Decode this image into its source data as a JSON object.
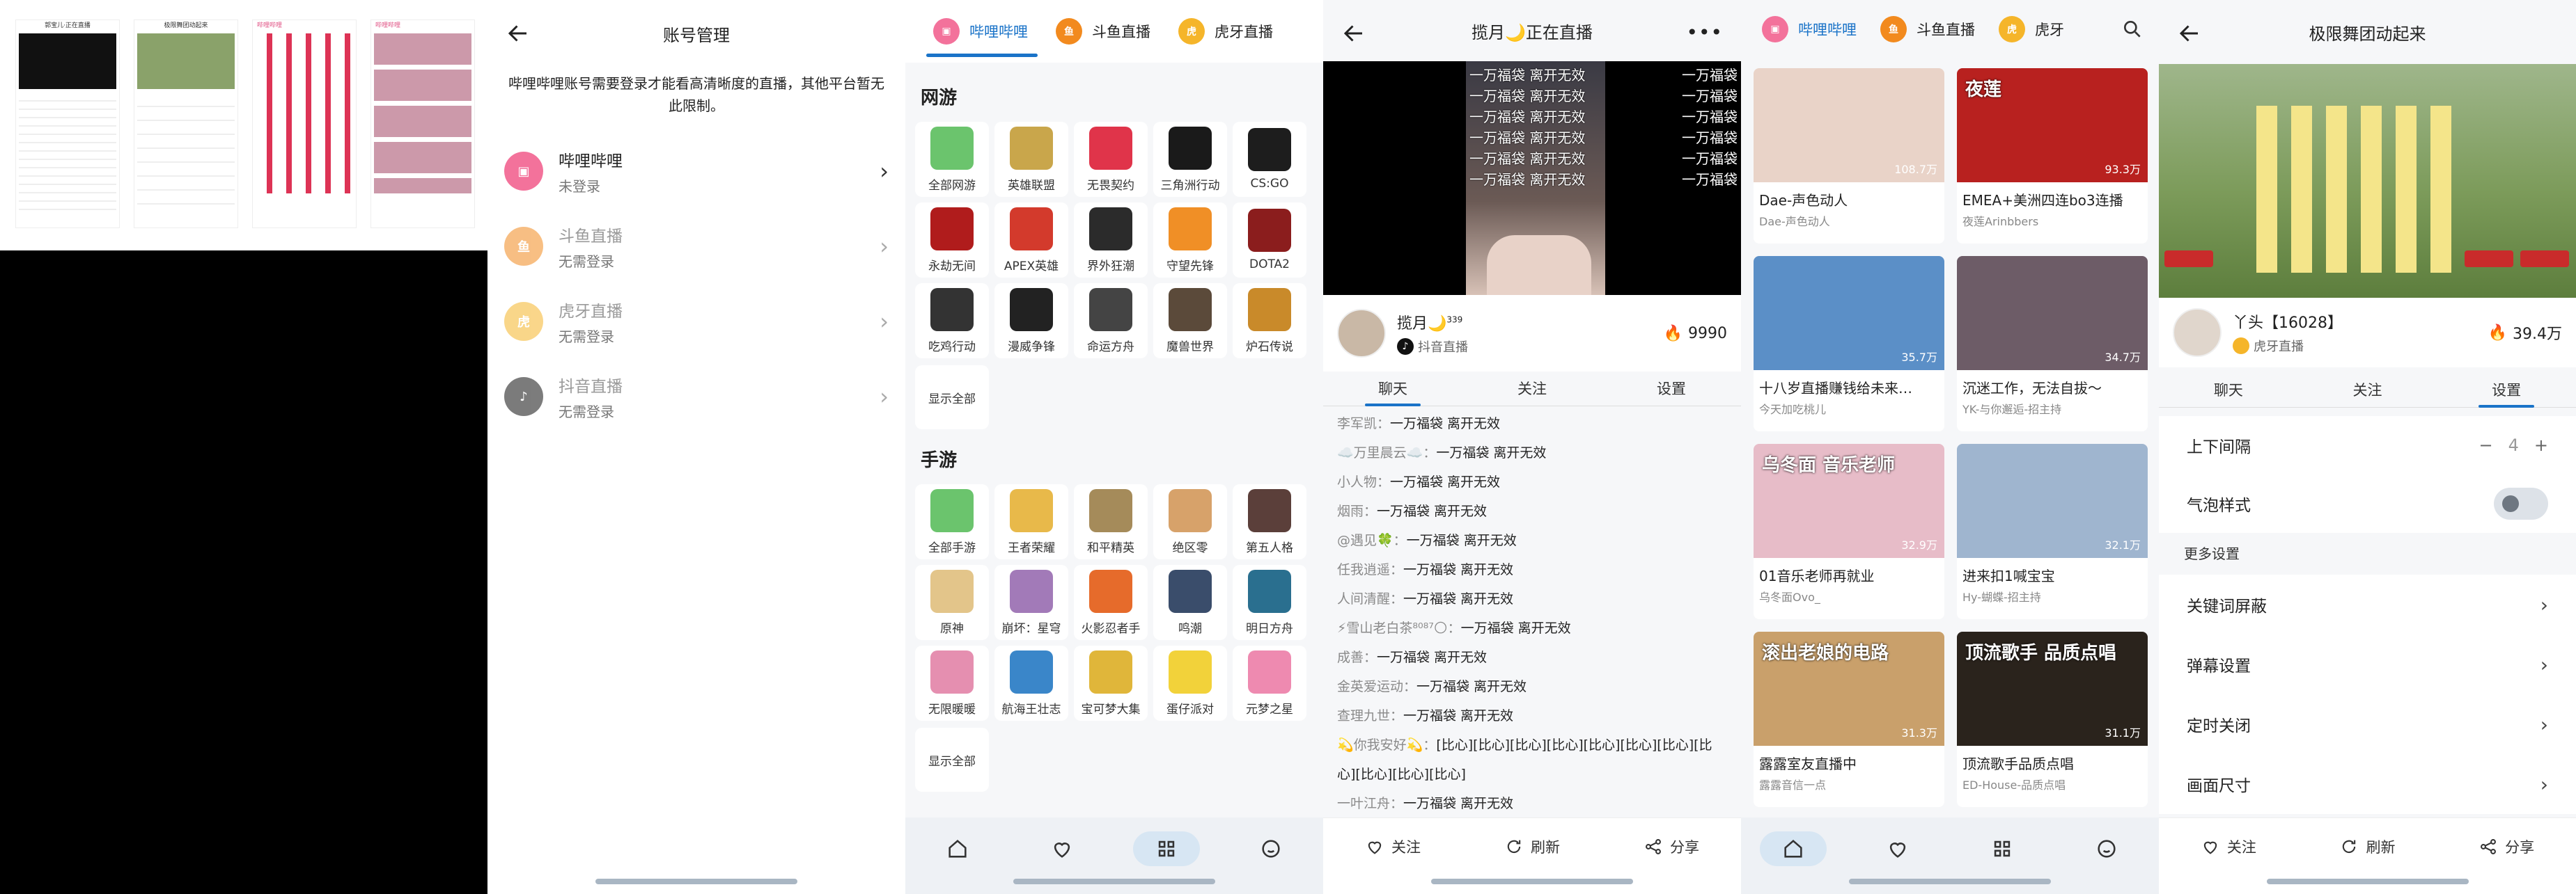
{
  "thumbs": {
    "t1_title": "郭宝儿·正在直播",
    "t2_title": "极限舞团动起来",
    "t3_title": "哔哩哔哩",
    "t4_title": "哔哩哔哩"
  },
  "account": {
    "title": "账号管理",
    "notice": "哔哩哔哩账号需要登录才能看高清晰度的直播，其他平台暂无此限制。",
    "items": [
      {
        "name": "哔哩哔哩",
        "status": "未登录"
      },
      {
        "name": "斗鱼直播",
        "status": "无需登录"
      },
      {
        "name": "虎牙直播",
        "status": "无需登录"
      },
      {
        "name": "抖音直播",
        "status": "无需登录"
      }
    ]
  },
  "categories": {
    "tabs": [
      "哔哩哔哩",
      "斗鱼直播",
      "虎牙直播"
    ],
    "net_title": "网游",
    "net": [
      "全部网游",
      "英雄联盟",
      "无畏契约",
      "三角洲行动",
      "CS:GO",
      "永劫无间",
      "APEX英雄",
      "界外狂潮",
      "守望先锋",
      "DOTA2",
      "吃鸡行动",
      "漫威争锋",
      "命运方舟",
      "魔兽世界",
      "炉石传说"
    ],
    "mobile_title": "手游",
    "mobile": [
      "全部手游",
      "王者荣耀",
      "和平精英",
      "绝区零",
      "第五人格",
      "原神",
      "崩坏：星穹",
      "火影忍者手",
      "鸣潮",
      "明日方舟",
      "无限暖暖",
      "航海王壮志",
      "宝可梦大集",
      "蛋仔派对",
      "元梦之星"
    ],
    "show_all": "显示全部"
  },
  "live1": {
    "title": "揽月🌙正在直播",
    "overlay_text": "一万福袋 离开无效",
    "host": "揽月🌙",
    "host_level": "339",
    "platform": "抖音直播",
    "popularity": "9990",
    "tabs": [
      "聊天",
      "关注",
      "设置"
    ],
    "messages": [
      {
        "user": "李军凯：",
        "text": "一万福袋 离开无效"
      },
      {
        "user": "☁️万里晨云☁️：",
        "text": "一万福袋 离开无效"
      },
      {
        "user": "小人物：",
        "text": "一万福袋 离开无效"
      },
      {
        "user": "烟雨：",
        "text": "一万福袋 离开无效"
      },
      {
        "user": "@遇见🍀：",
        "text": "一万福袋 离开无效"
      },
      {
        "user": "任我逍遥：",
        "text": "一万福袋 离开无效"
      },
      {
        "user": "人间清醒：",
        "text": "一万福袋 离开无效"
      },
      {
        "user": "⚡雪山老白茶⁸⁰⁸⁷🌕：",
        "text": "一万福袋 离开无效"
      },
      {
        "user": "成善：",
        "text": "一万福袋 离开无效"
      },
      {
        "user": "金英爱运动：",
        "text": "一万福袋 离开无效"
      },
      {
        "user": "查理九世：",
        "text": "一万福袋 离开无效"
      },
      {
        "user": "💫你我安好💫：",
        "text": "[比心][比心][比心][比心][比心][比心][比心][比心][比心][比心][比心]"
      },
      {
        "user": "一叶江舟：",
        "text": "一万福袋 离开无效"
      }
    ],
    "actions": [
      "关注",
      "刷新",
      "分享"
    ]
  },
  "home": {
    "tabs": [
      "哔哩哔哩",
      "斗鱼直播",
      "虎牙"
    ],
    "cards": [
      {
        "title": "Dae-声色动人",
        "sub": "Dae-声色动人",
        "views": "108.7万",
        "color": "#e9d3c8"
      },
      {
        "title": "EMEA+美洲四连bo3连播",
        "sub": "夜莲Arinbbers",
        "views": "93.3万",
        "color": "#b8211f",
        "overlay": "夜莲"
      },
      {
        "title": "十八岁直播赚钱给未来…",
        "sub": "今天加吃桃儿",
        "views": "35.7万",
        "color": "#5b8fc7"
      },
      {
        "title": "沉迷工作，无法自拔～",
        "sub": "YK-与你邂逅-招主持",
        "views": "34.7万",
        "color": "#6d5c67"
      },
      {
        "title": "01音乐老师再就业",
        "sub": "乌冬面Ovo_",
        "views": "32.9万",
        "color": "#e7bcc8",
        "overlay": "乌冬面 音乐老师"
      },
      {
        "title": "进来扣1喊宝宝",
        "sub": "Hy-蝴蝶-招主持",
        "views": "32.1万",
        "color": "#9fb5cf"
      },
      {
        "title": "露露室友直播中",
        "sub": "露露音信一点",
        "views": "31.3万",
        "color": "#c9a06b",
        "overlay": "滚出老娘的电路"
      },
      {
        "title": "顶流歌手品质点唱",
        "sub": "ED-House-品质点唱",
        "views": "31.1万",
        "color": "#2a231c",
        "overlay": "顶流歌手 品质点唱"
      }
    ]
  },
  "live2": {
    "title": "极限舞团动起来",
    "host": "丫头【16028】",
    "platform": "虎牙直播",
    "popularity": "39.4万",
    "tabs": [
      "聊天",
      "关注",
      "设置"
    ],
    "settings": {
      "spacing_label": "上下间隔",
      "spacing_value": "4",
      "bubble_label": "气泡样式",
      "more_label": "更多设置",
      "rows": [
        "关键词屏蔽",
        "弹幕设置",
        "定时关闭",
        "画面尺寸"
      ]
    },
    "actions": [
      "关注",
      "刷新",
      "分享"
    ]
  }
}
